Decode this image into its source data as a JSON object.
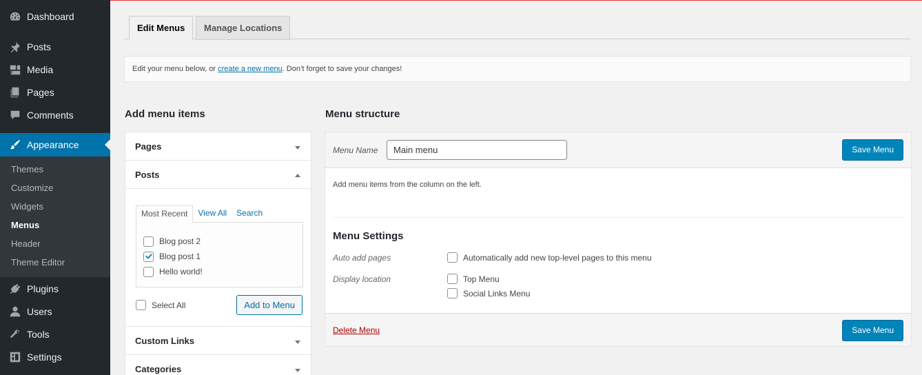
{
  "sidebar": {
    "top_items": [
      {
        "label": "Dashboard",
        "icon": "dashboard-icon"
      },
      {
        "label": "Posts",
        "icon": "pin-icon"
      },
      {
        "label": "Media",
        "icon": "media-icon"
      },
      {
        "label": "Pages",
        "icon": "pages-icon"
      },
      {
        "label": "Comments",
        "icon": "comments-icon"
      }
    ],
    "appearance": {
      "label": "Appearance",
      "icon": "paintbrush-icon"
    },
    "submenu": [
      "Themes",
      "Customize",
      "Widgets",
      "Menus",
      "Header",
      "Theme Editor"
    ],
    "current_submenu": "Menus",
    "bottom_items": [
      {
        "label": "Plugins",
        "icon": "plugins-icon"
      },
      {
        "label": "Users",
        "icon": "users-icon"
      },
      {
        "label": "Tools",
        "icon": "wrench-icon"
      },
      {
        "label": "Settings",
        "icon": "settings-icon"
      }
    ]
  },
  "tabs": {
    "edit": "Edit Menus",
    "manage": "Manage Locations"
  },
  "notice": {
    "before": "Edit your menu below, or ",
    "link": "create a new menu",
    "after": ". Don’t forget to save your changes!"
  },
  "left": {
    "heading": "Add menu items",
    "pages_label": "Pages",
    "posts_label": "Posts",
    "inner_tabs": {
      "recent": "Most Recent",
      "all": "View All",
      "search": "Search"
    },
    "posts": [
      {
        "title": "Blog post 2",
        "checked": false
      },
      {
        "title": "Blog post 1",
        "checked": true
      },
      {
        "title": "Hello world!",
        "checked": false
      }
    ],
    "select_all": "Select All",
    "add_button": "Add to Menu",
    "custom_links_label": "Custom Links",
    "categories_label": "Categories"
  },
  "right": {
    "heading": "Menu structure",
    "menu_name_label": "Menu Name",
    "menu_name_value": "Main menu",
    "save_label": "Save Menu",
    "hint": "Add menu items from the column on the left.",
    "settings_title": "Menu Settings",
    "auto_add_label": "Auto add pages",
    "auto_add_option": "Automatically add new top-level pages to this menu",
    "display_location_label": "Display location",
    "locations": [
      "Top Menu",
      "Social Links Menu"
    ],
    "delete_label": "Delete Menu"
  },
  "colors": {
    "accent": "#0073aa",
    "primary_button": "#0085ba",
    "sidebar": "#23282d",
    "delete": "#aa0000"
  }
}
